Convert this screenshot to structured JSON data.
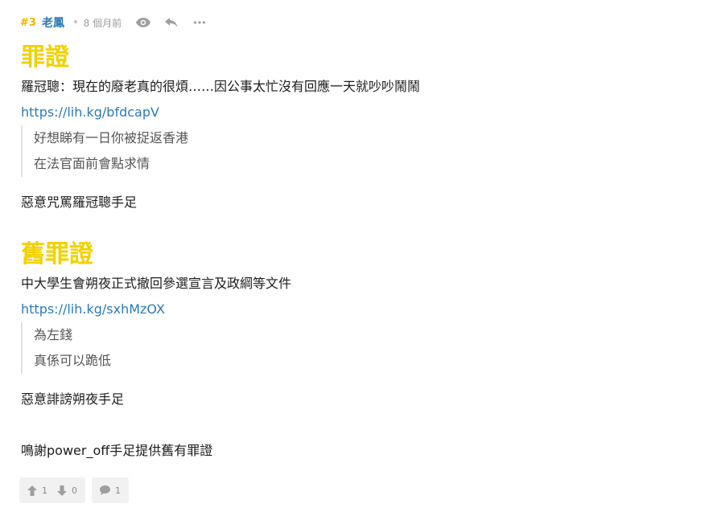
{
  "post": {
    "number": "#3",
    "author": "老鳳",
    "time": "8 個月前"
  },
  "icons": {
    "view": "eye-icon",
    "reply": "reply-icon",
    "more": "more-icon",
    "upvote": "arrow-up-icon",
    "downvote": "arrow-down-icon",
    "comment": "comment-icon"
  },
  "sections": [
    {
      "heading": "罪證",
      "text": "羅冠聰：現在的廢老真的很煩……因公事太忙沒有回應一天就吵吵鬧鬧",
      "link": "https://lih.kg/bfdcapV",
      "quote": [
        "好想睇有一日你被捉返香港",
        "在法官面前會點求情"
      ],
      "footer_text": "惡意咒罵羅冠聰手足"
    },
    {
      "heading": "舊罪證",
      "text": "中大學生會朔夜正式撤回參選宣言及政綱等文件",
      "link": "https://lih.kg/sxhMzOX",
      "quote": [
        "為左錢",
        "真係可以跪低"
      ],
      "footer_text": "惡意誹謗朔夜手足"
    }
  ],
  "thanks": "鳴謝power_off手足提供舊有罪證",
  "votes": {
    "up": "1",
    "down": "0",
    "comments": "1"
  },
  "colors": {
    "heading": "#f3d100",
    "number": "#f0b300",
    "link": "#2a7ab8"
  }
}
